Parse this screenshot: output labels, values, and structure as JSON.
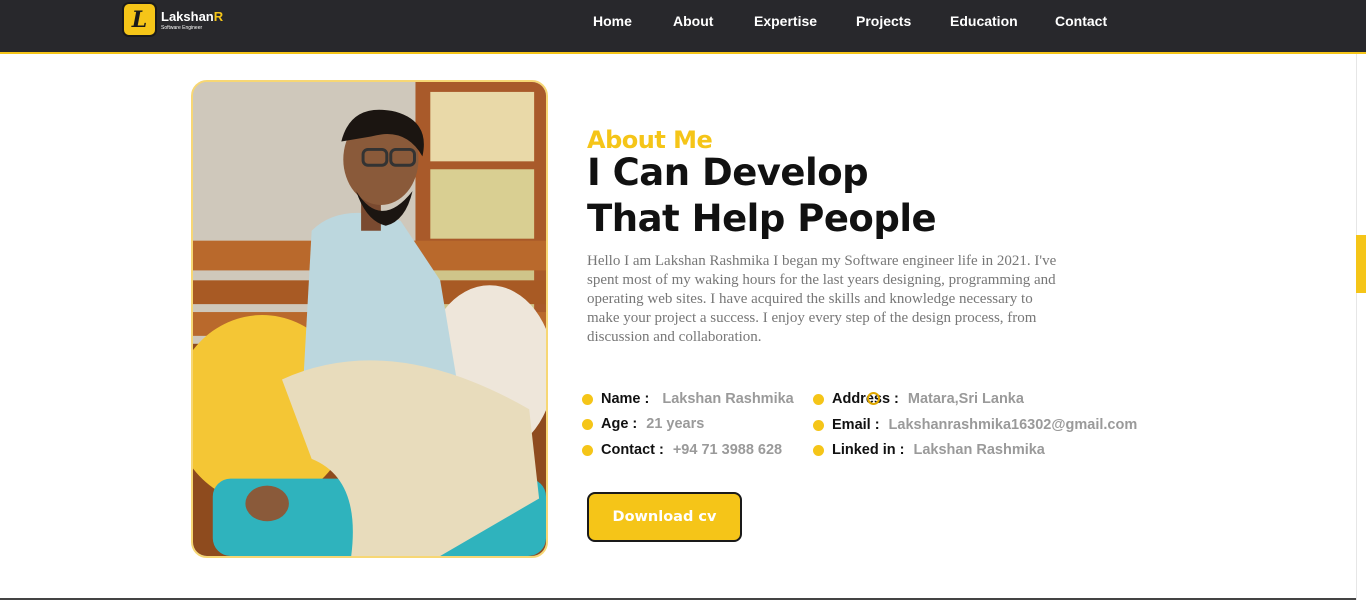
{
  "brand": {
    "badge_letter": "L",
    "name_main": "Lakshan",
    "name_accent": "R",
    "tagline": "Software Engineer",
    "accent_color": "#f5c518",
    "nav_bg": "#28282c"
  },
  "nav": {
    "items": [
      "Home",
      "About",
      "Expertise",
      "Projects",
      "Education",
      "Contact"
    ]
  },
  "about": {
    "eyebrow": "About Me",
    "headline_line1": "I Can Develop",
    "headline_line2": "That Help People",
    "bio": "Hello I am Lakshan Rashmika I began my Software engineer life in 2021. I've spent most of my waking hours for the last years designing, programming and operating web sites. I have acquired the skills and knowledge necessary to make your project a success. I enjoy every step of the design process, from discussion and collaboration."
  },
  "info": {
    "name_label": "Name :",
    "name_value": "Lakshan Rashmika",
    "age_label": "Age :",
    "age_value": "21 years",
    "contact_label": "Contact :",
    "contact_value": "+94 71 3988 628",
    "address_label": "Address :",
    "address_value": "Matara,Sri Lanka",
    "email_label": "Email :",
    "email_value": "Lakshanrashmika16302@gmail.com",
    "linkedin_label": "Linked in :",
    "linkedin_value": "Lakshan Rashmika"
  },
  "cta": {
    "download_label": "Download cv"
  }
}
